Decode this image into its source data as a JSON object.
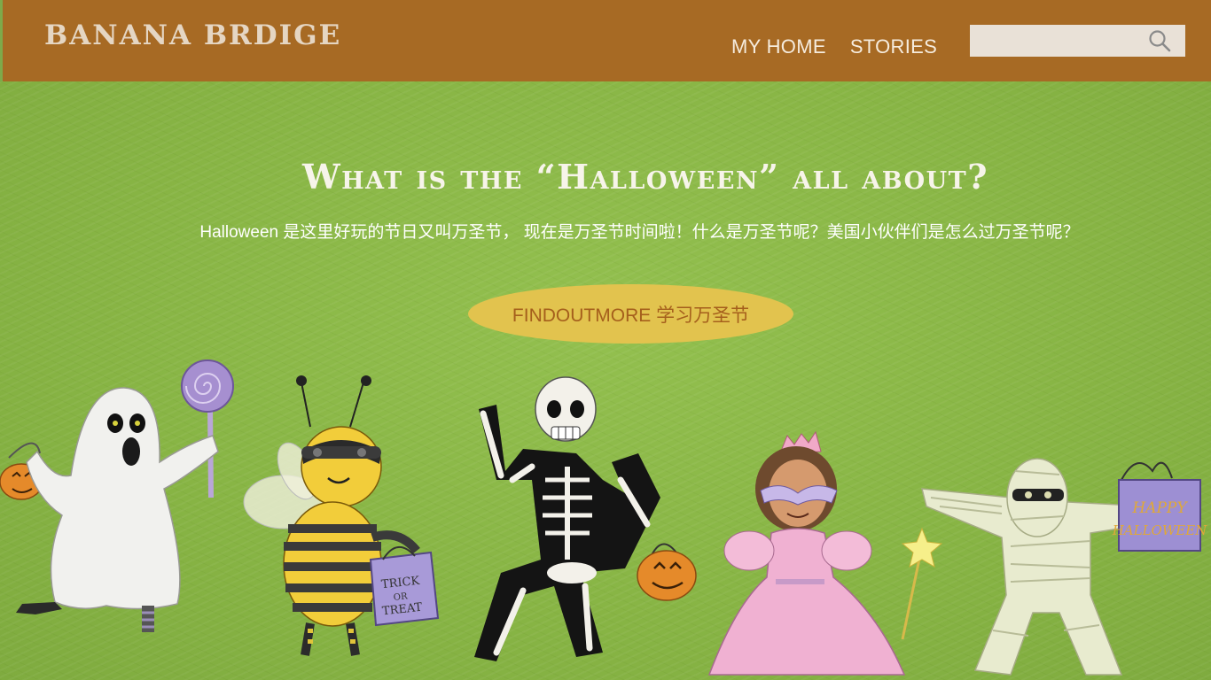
{
  "header": {
    "brand": "BANANA BRDIGE",
    "nav": [
      {
        "label": "MY HOME"
      },
      {
        "label": "STORIES"
      }
    ],
    "search": {
      "placeholder": "",
      "icon": "search-icon"
    }
  },
  "hero": {
    "headline": "What is the “Halloween” all about?",
    "subline": "Halloween 是这里好玩的节日又叫万圣节， 现在是万圣节时间啦！什么是万圣节呢？美国小伙伴们是怎么过万圣节呢？",
    "cta_label": "FINDOUTMORE  学习万圣节",
    "illustration": {
      "bag_text_left": "TRICK OR TREAT",
      "bag_text_right": "HAPPY HALLOWEEN"
    }
  },
  "colors": {
    "header_bg": "#a76a24",
    "hero_bg": "#8bb847",
    "cta_bg": "#e2c34e",
    "cta_text": "#a55f1c"
  }
}
